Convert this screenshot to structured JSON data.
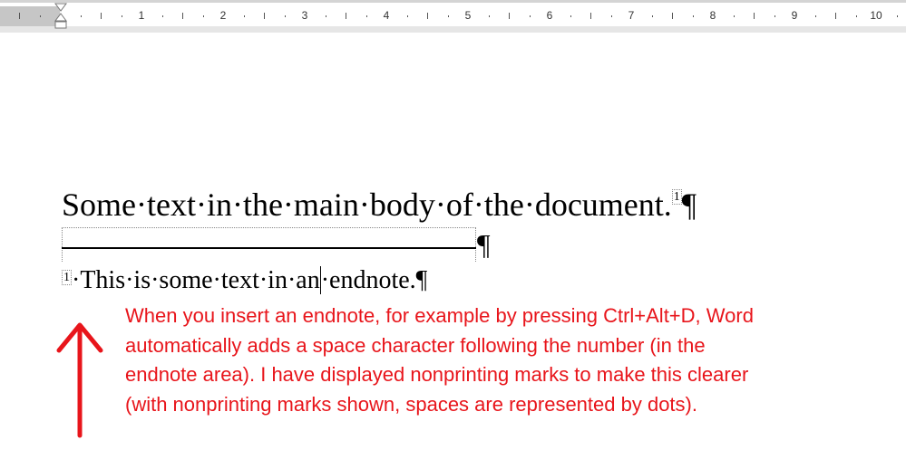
{
  "ruler": {
    "labels": [
      "1",
      "2",
      "3",
      "4",
      "5",
      "6",
      "7",
      "8",
      "9",
      "10"
    ]
  },
  "document": {
    "main_text": "Some·text·in·the·main·body·of·the·document.",
    "endnote_ref": "1",
    "pilcrow": "¶",
    "endnote_before_cursor": "·This·is·some·text·in·an",
    "endnote_after_cursor": "·endnote."
  },
  "callout": {
    "lines": [
      "When you insert an endnote, for example by pressing Ctrl+Alt+D, Word",
      "automatically adds a space character following the number (in the",
      "endnote area). I have displayed nonprinting marks to make this clearer",
      "(with nonprinting marks shown, spaces are represented by dots)."
    ],
    "color": "#e8151b"
  }
}
